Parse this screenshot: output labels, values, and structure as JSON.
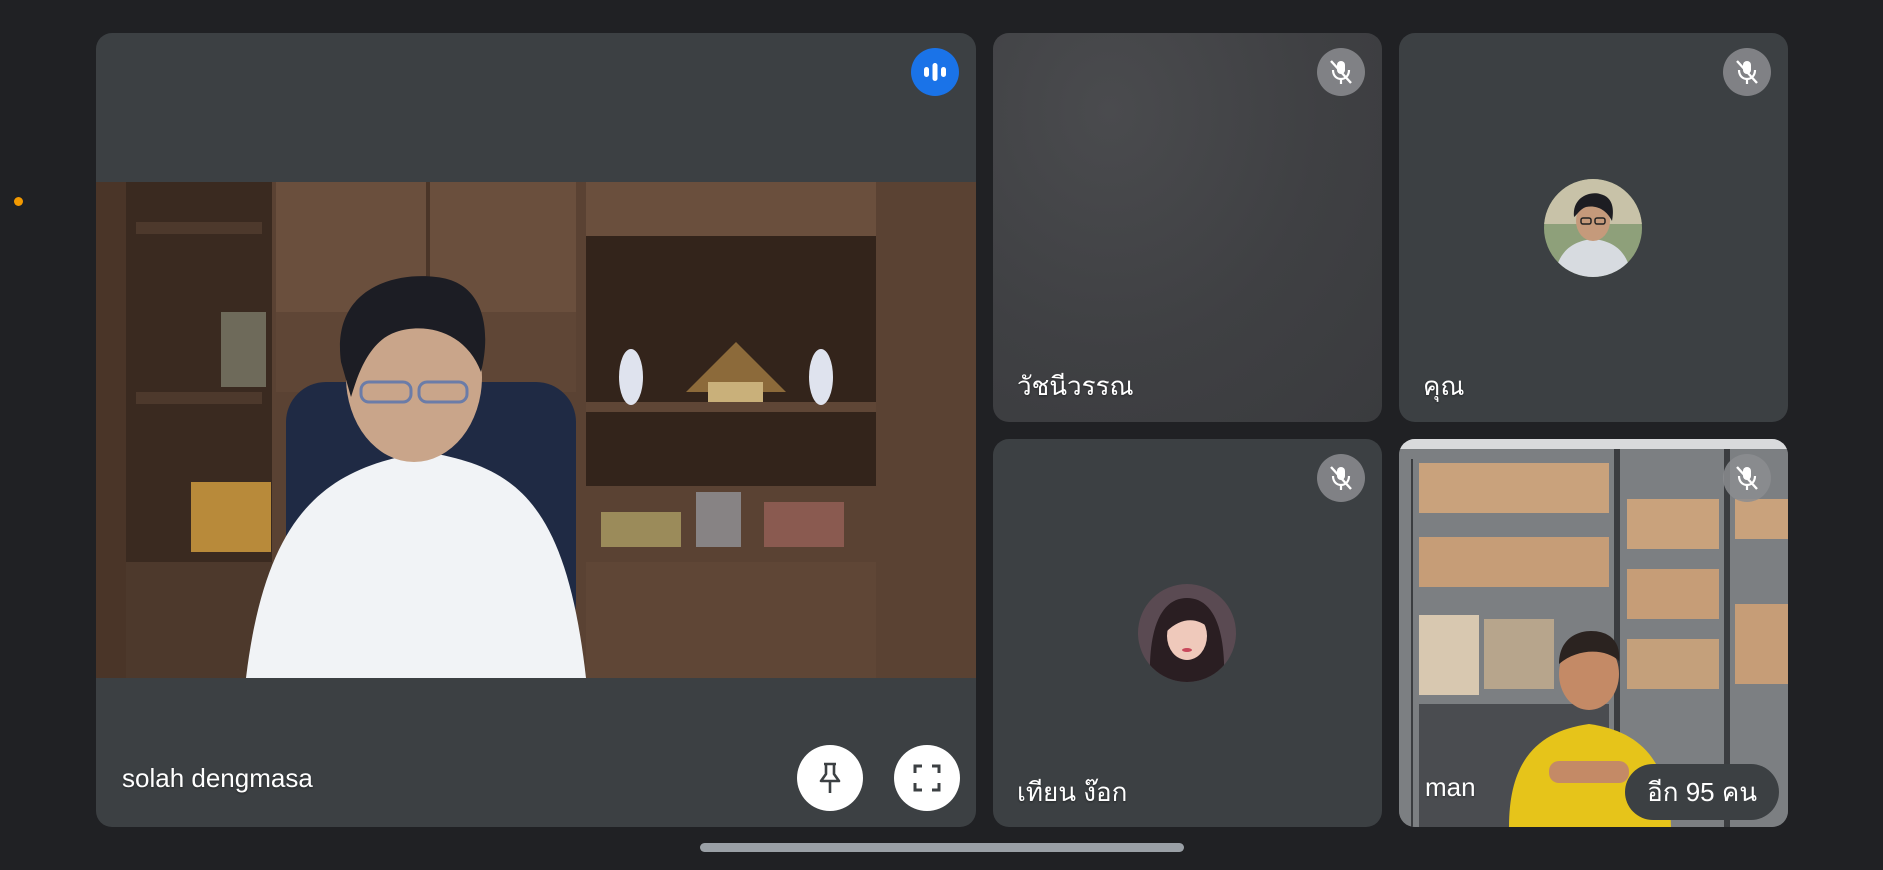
{
  "meeting": {
    "participants": [
      {
        "id": "main",
        "name": "solah dengmasa",
        "state": "speaking"
      },
      {
        "id": "a",
        "name": "วัชนีวรรณ",
        "state": "muted"
      },
      {
        "id": "b",
        "name": "คุณ",
        "state": "muted"
      },
      {
        "id": "c",
        "name": "เทียน ง๊อก",
        "state": "muted"
      },
      {
        "id": "d",
        "name": "man",
        "state": "muted"
      }
    ],
    "more_participants": "อีก 95 คน"
  },
  "icons": {
    "speaking": "audio-level-icon",
    "muted": "mic-off-icon",
    "pin": "pin-icon",
    "fullscreen": "fullscreen-icon"
  },
  "colors": {
    "background": "#202124",
    "tile": "#3c4043",
    "speaking_accent": "#1a73e8",
    "status_dot": "#f29900"
  }
}
